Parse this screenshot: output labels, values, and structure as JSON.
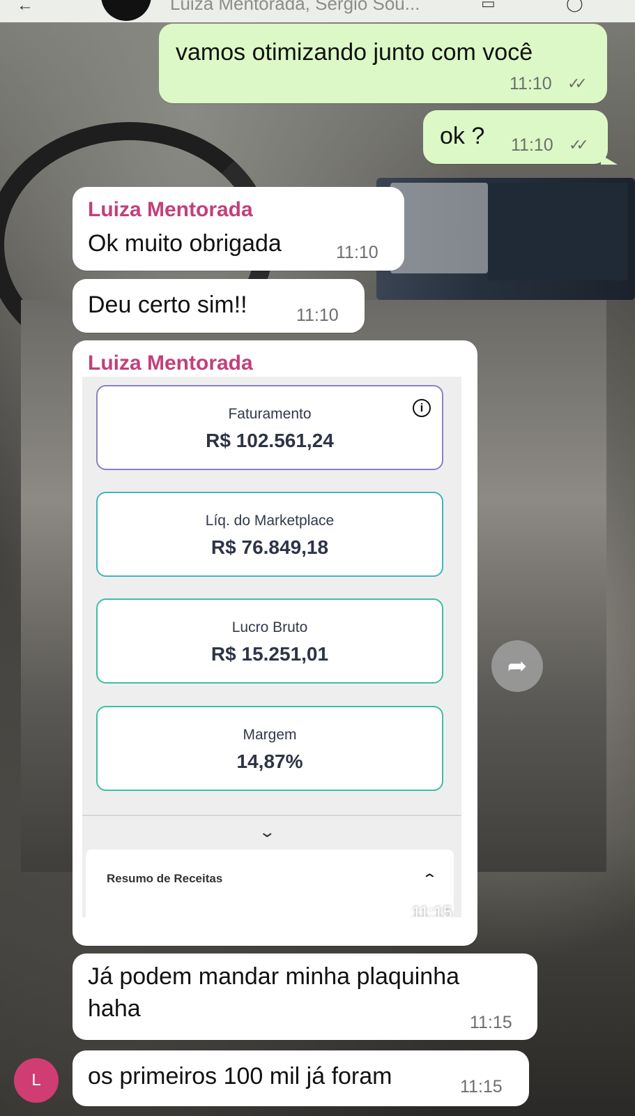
{
  "header": {
    "title": "Luiza Mentorada, Sergio Sou..."
  },
  "messages": {
    "m1": {
      "text": "vamos otimizando junto com você",
      "time": "11:10"
    },
    "m2": {
      "text": "ok ?",
      "time": "11:10"
    },
    "m3": {
      "sender": "Luiza Mentorada",
      "text": "Ok muito obrigada",
      "time": "11:10"
    },
    "m4": {
      "text": "Deu certo sim!!",
      "time": "11:10"
    },
    "m5": {
      "sender": "Luiza Mentorada",
      "time": "11:15",
      "image": {
        "metrics": [
          {
            "label": "Faturamento",
            "value": "R$ 102.561,24"
          },
          {
            "label": "Líq. do Marketplace",
            "value": "R$ 76.849,18"
          },
          {
            "label": "Lucro Bruto",
            "value": "R$ 15.251,01"
          },
          {
            "label": "Margem",
            "value": "14,87%"
          }
        ],
        "summary_label": "Resumo de Receitas"
      }
    },
    "m6": {
      "line1": "Já podem mandar minha plaquinha",
      "line2": "haha",
      "time": "11:15"
    },
    "m7": {
      "text": "os primeiros 100 mil já foram",
      "time": "11:15",
      "avatar_letter": "L"
    }
  },
  "colors": {
    "outgoing_bubble": "#dcf8c6",
    "incoming_bubble": "#ffffff",
    "sender_name": "#c2407a",
    "avatar": "#d03d73"
  },
  "icons": {
    "ticks": "double-check-icon",
    "info": "info-icon",
    "forward": "forward-icon",
    "chevron_down": "chevron-down-icon",
    "chevron_up": "chevron-up-icon"
  }
}
